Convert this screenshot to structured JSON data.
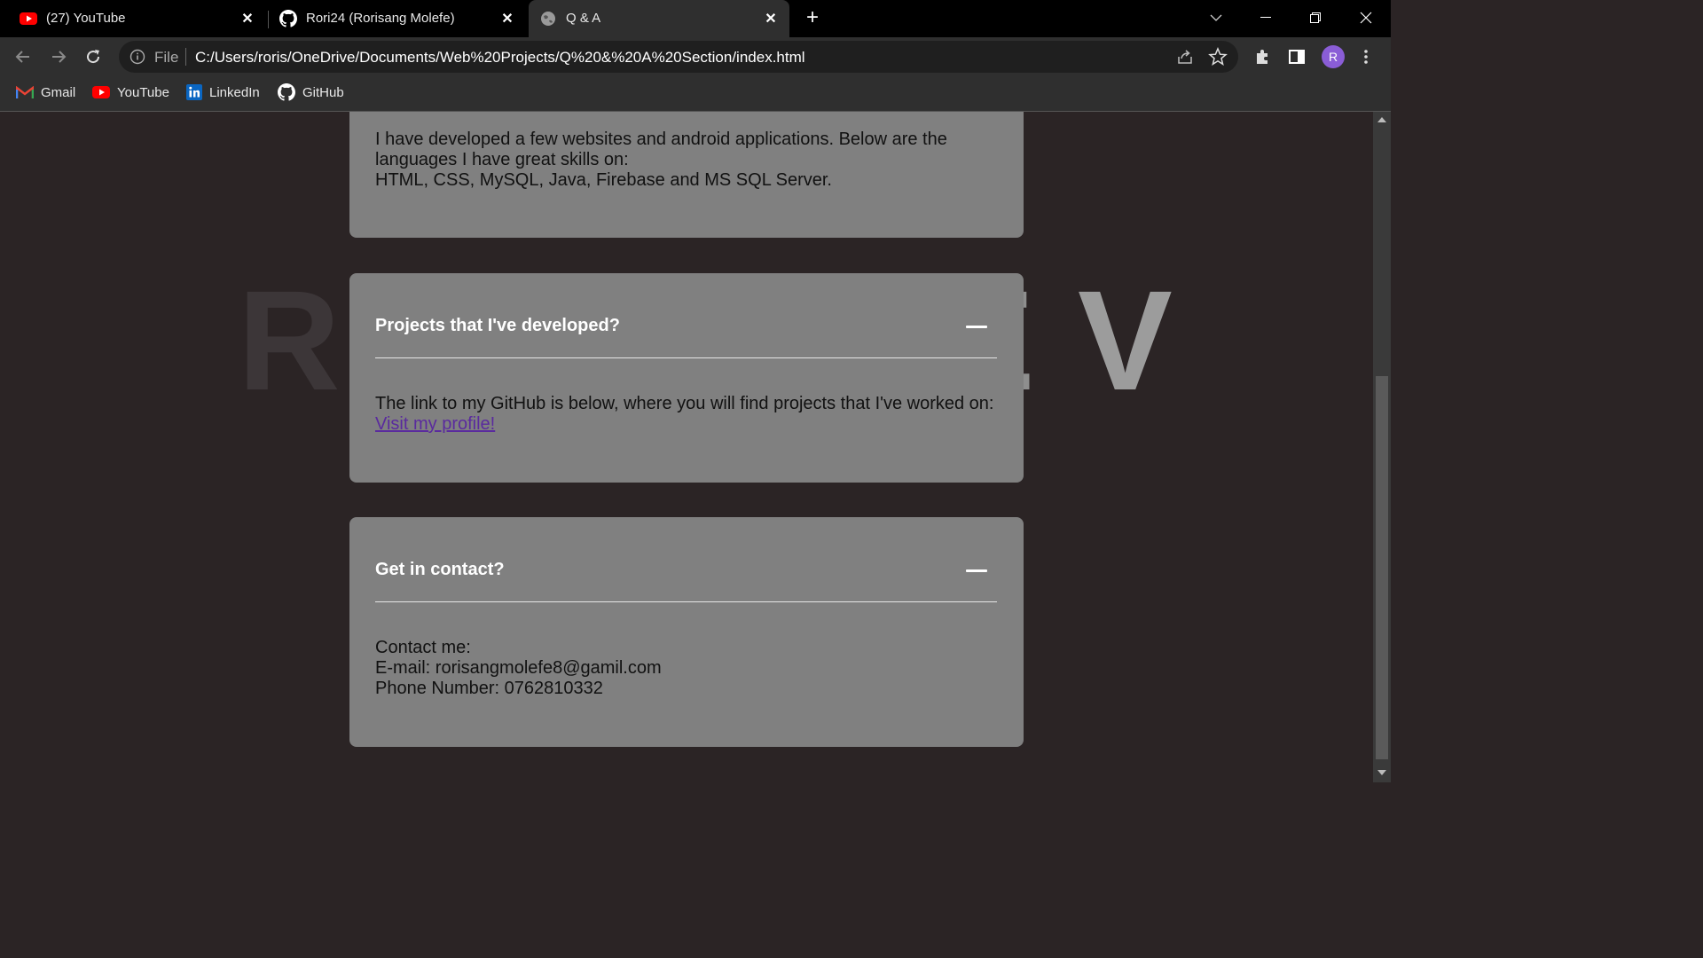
{
  "tabs": [
    {
      "title": "(27) YouTube",
      "icon": "youtube-icon"
    },
    {
      "title": "Rori24 (Rorisang Molefe)",
      "icon": "github-icon"
    },
    {
      "title": "Q & A",
      "icon": "globe-icon",
      "active": true
    }
  ],
  "address_bar": {
    "scheme_label": "File",
    "url": "C:/Users/roris/OneDrive/Documents/Web%20Projects/Q%20&%20A%20Section/index.html"
  },
  "profile": {
    "initial": "R",
    "color": "#8a5dd6"
  },
  "bookmarks": [
    {
      "label": "Gmail",
      "icon": "gmail-icon"
    },
    {
      "label": "YouTube",
      "icon": "youtube-icon"
    },
    {
      "label": "LinkedIn",
      "icon": "linkedin-icon"
    },
    {
      "label": "GitHub",
      "icon": "github-icon"
    }
  ],
  "background_letters": [
    "R",
    "E",
    "V"
  ],
  "qa": [
    {
      "answer_lines": [
        "I have developed a few websites and android applications. Below are the",
        "languages I have great skills on:",
        "HTML, CSS, MySQL, Java, Firebase and MS SQL Server."
      ]
    },
    {
      "question": "Projects that I've developed?",
      "answer_lines": [
        "The link to my GitHub is below, where you will find projects that I've worked on:"
      ],
      "link_text": "Visit my profile!"
    },
    {
      "question": "Get in contact?",
      "answer_lines": [
        "Contact me:",
        "E-mail: rorisangmolefe8@gamil.com",
        "Phone Number: 0762810332"
      ]
    }
  ],
  "colors": {
    "page_background": "#2b2425",
    "card_background": "#808080",
    "link": "#5a2a9e"
  }
}
